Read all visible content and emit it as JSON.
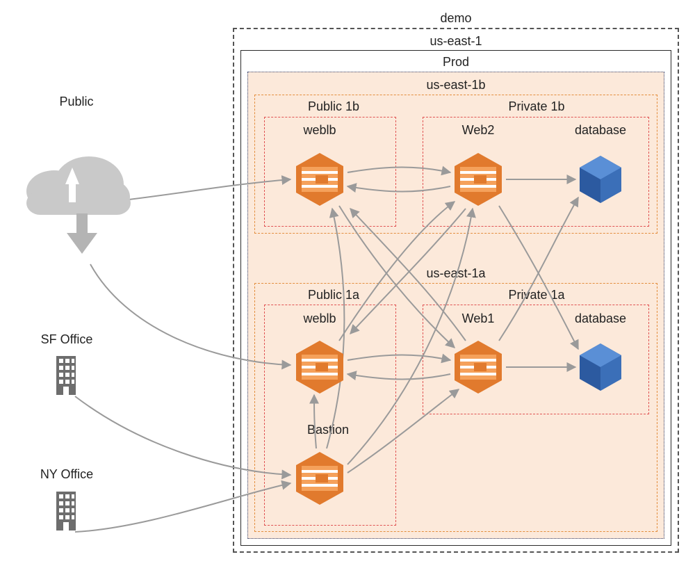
{
  "external": {
    "public": "Public",
    "sf_office": "SF Office",
    "ny_office": "NY Office"
  },
  "containers": {
    "account": "demo",
    "region": "us-east-1",
    "vpc": "Prod",
    "az_b": "us-east-1b",
    "az_a": "us-east-1a",
    "public_1b": "Public 1b",
    "private_1b": "Private 1b",
    "public_1a": "Public 1a",
    "private_1a": "Private 1a"
  },
  "nodes": {
    "weblb_b": "weblb",
    "web2": "Web2",
    "db_b": "database",
    "weblb_a": "weblb",
    "web1": "Web1",
    "db_a": "database",
    "bastion": "Bastion"
  },
  "chart_data": {
    "type": "network-diagram",
    "external_nodes": [
      {
        "id": "public",
        "label": "Public",
        "icon": "cloud"
      },
      {
        "id": "sf_office",
        "label": "SF Office",
        "icon": "building"
      },
      {
        "id": "ny_office",
        "label": "NY Office",
        "icon": "building"
      }
    ],
    "containers": [
      {
        "id": "account",
        "label": "demo",
        "style": "dashed-black"
      },
      {
        "id": "region",
        "label": "us-east-1",
        "style": "solid-black",
        "parent": "account"
      },
      {
        "id": "vpc",
        "label": "Prod",
        "style": "dotted-navy",
        "parent": "region"
      },
      {
        "id": "az_b",
        "label": "us-east-1b",
        "style": "dashed-orange",
        "parent": "vpc"
      },
      {
        "id": "az_a",
        "label": "us-east-1a",
        "style": "dashed-orange",
        "parent": "vpc"
      },
      {
        "id": "public_1b",
        "label": "Public 1b",
        "style": "dashed-red",
        "parent": "az_b"
      },
      {
        "id": "private_1b",
        "label": "Private 1b",
        "style": "dashed-red",
        "parent": "az_b"
      },
      {
        "id": "public_1a",
        "label": "Public 1a",
        "style": "dashed-red",
        "parent": "az_a"
      },
      {
        "id": "private_1a",
        "label": "Private 1a",
        "style": "dashed-red",
        "parent": "az_a"
      }
    ],
    "nodes": [
      {
        "id": "weblb_b",
        "label": "weblb",
        "type": "ec2",
        "subnet": "public_1b"
      },
      {
        "id": "web2",
        "label": "Web2",
        "type": "ec2",
        "subnet": "private_1b"
      },
      {
        "id": "db_b",
        "label": "database",
        "type": "database",
        "subnet": "private_1b"
      },
      {
        "id": "weblb_a",
        "label": "weblb",
        "type": "ec2",
        "subnet": "public_1a"
      },
      {
        "id": "web1",
        "label": "Web1",
        "type": "ec2",
        "subnet": "private_1a"
      },
      {
        "id": "db_a",
        "label": "database",
        "type": "database",
        "subnet": "private_1a"
      },
      {
        "id": "bastion",
        "label": "Bastion",
        "type": "ec2",
        "subnet": "public_1a"
      }
    ],
    "edges": [
      {
        "from": "public",
        "to": "weblb_b"
      },
      {
        "from": "public",
        "to": "weblb_a"
      },
      {
        "from": "sf_office",
        "to": "bastion"
      },
      {
        "from": "ny_office",
        "to": "bastion"
      },
      {
        "from": "weblb_b",
        "to": "web2",
        "bidirectional": true
      },
      {
        "from": "weblb_b",
        "to": "web1",
        "bidirectional": true
      },
      {
        "from": "weblb_a",
        "to": "web2",
        "bidirectional": true
      },
      {
        "from": "weblb_a",
        "to": "web1",
        "bidirectional": true
      },
      {
        "from": "web2",
        "to": "db_b"
      },
      {
        "from": "web2",
        "to": "db_a"
      },
      {
        "from": "web1",
        "to": "db_b"
      },
      {
        "from": "web1",
        "to": "db_a"
      },
      {
        "from": "bastion",
        "to": "weblb_a"
      },
      {
        "from": "bastion",
        "to": "weblb_b"
      },
      {
        "from": "bastion",
        "to": "web1"
      },
      {
        "from": "bastion",
        "to": "web2"
      }
    ]
  }
}
